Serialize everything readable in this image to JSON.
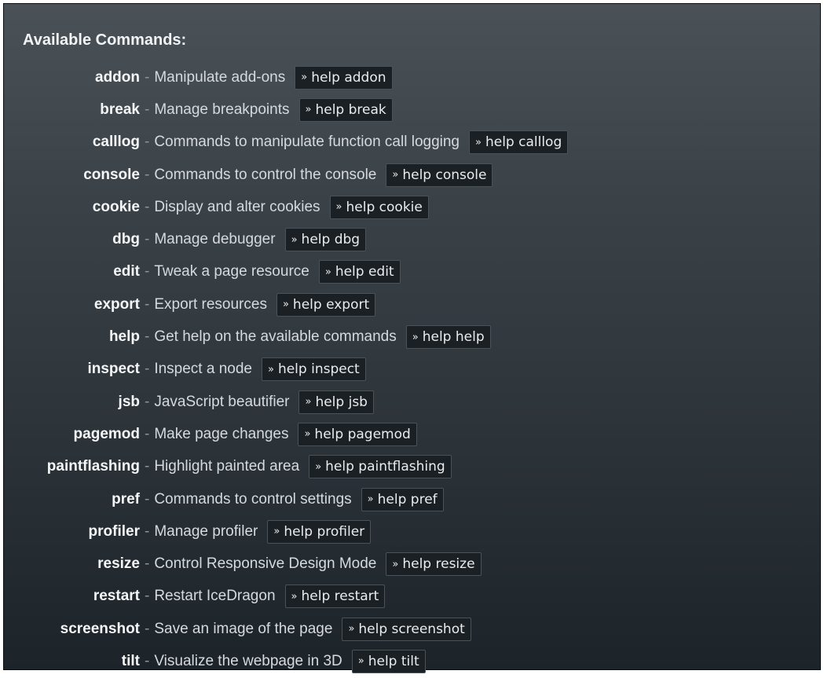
{
  "heading": "Available Commands:",
  "separator": "-",
  "help_prefix_icon": "»",
  "commands": [
    {
      "name": "addon",
      "desc": "Manipulate add-ons",
      "help": "help addon"
    },
    {
      "name": "break",
      "desc": "Manage breakpoints",
      "help": "help break"
    },
    {
      "name": "calllog",
      "desc": "Commands to manipulate function call logging",
      "help": "help calllog"
    },
    {
      "name": "console",
      "desc": "Commands to control the console",
      "help": "help console"
    },
    {
      "name": "cookie",
      "desc": "Display and alter cookies",
      "help": "help cookie"
    },
    {
      "name": "dbg",
      "desc": "Manage debugger",
      "help": "help dbg"
    },
    {
      "name": "edit",
      "desc": "Tweak a page resource",
      "help": "help edit"
    },
    {
      "name": "export",
      "desc": "Export resources",
      "help": "help export"
    },
    {
      "name": "help",
      "desc": "Get help on the available commands",
      "help": "help help"
    },
    {
      "name": "inspect",
      "desc": "Inspect a node",
      "help": "help inspect"
    },
    {
      "name": "jsb",
      "desc": "JavaScript beautifier",
      "help": "help jsb"
    },
    {
      "name": "pagemod",
      "desc": "Make page changes",
      "help": "help pagemod"
    },
    {
      "name": "paintflashing",
      "desc": "Highlight painted area",
      "help": "help paintflashing"
    },
    {
      "name": "pref",
      "desc": "Commands to control settings",
      "help": "help pref"
    },
    {
      "name": "profiler",
      "desc": "Manage profiler",
      "help": "help profiler"
    },
    {
      "name": "resize",
      "desc": "Control Responsive Design Mode",
      "help": "help resize"
    },
    {
      "name": "restart",
      "desc": "Restart IceDragon",
      "help": "help restart"
    },
    {
      "name": "screenshot",
      "desc": "Save an image of the page",
      "help": "help screenshot"
    },
    {
      "name": "tilt",
      "desc": "Visualize the webpage in 3D",
      "help": "help tilt"
    }
  ]
}
